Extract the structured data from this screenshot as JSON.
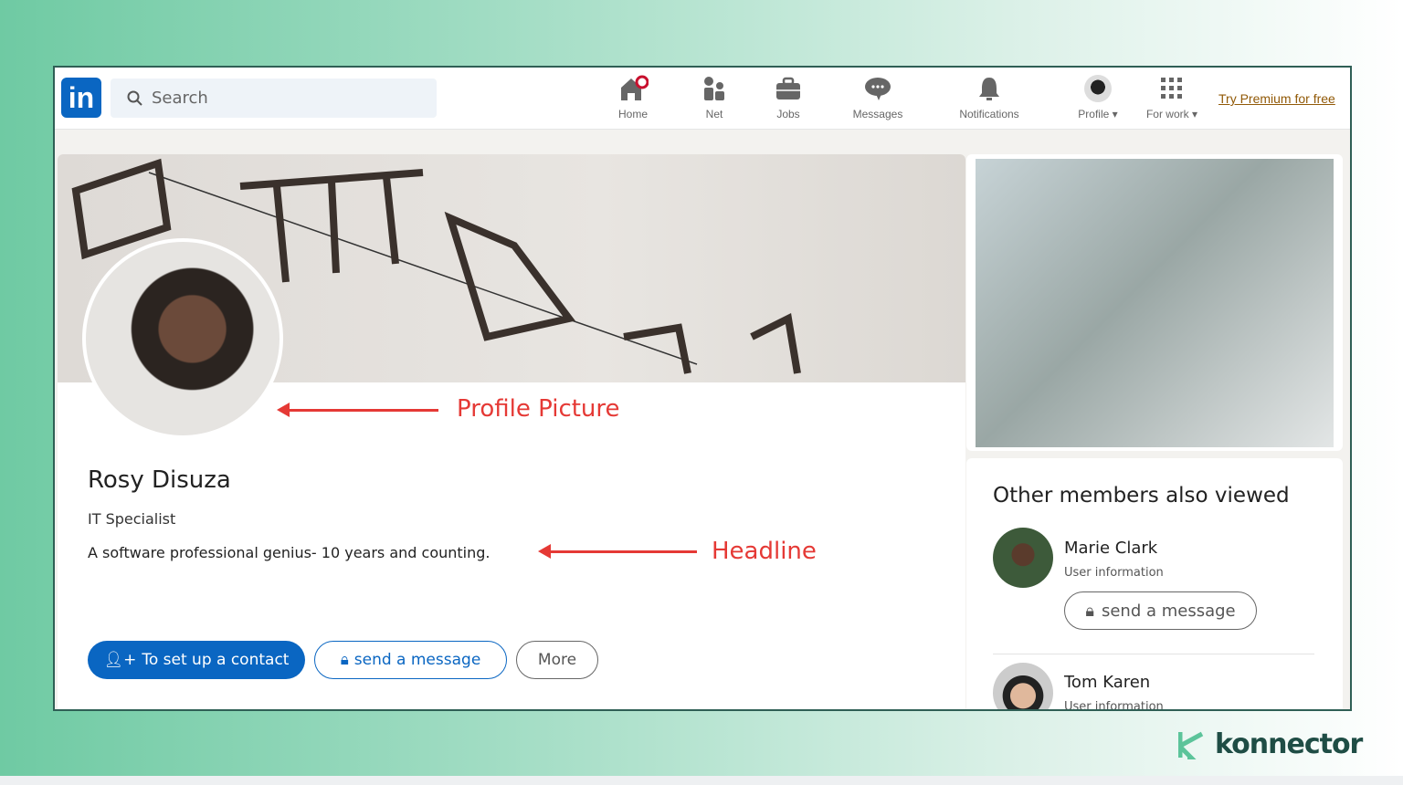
{
  "nav": {
    "logo": "in",
    "search_placeholder": "Search",
    "items": [
      {
        "label": "Home",
        "icon": "home-icon"
      },
      {
        "label": "Net",
        "icon": "network-icon"
      },
      {
        "label": "Jobs",
        "icon": "briefcase-icon"
      },
      {
        "label": "Messages",
        "icon": "chat-icon"
      },
      {
        "label": "Notifications",
        "icon": "bell-icon"
      },
      {
        "label": "Profile",
        "icon": "avatar"
      },
      {
        "label": "For work",
        "icon": "grid-icon"
      }
    ],
    "premium": "Try Premium for free"
  },
  "profile": {
    "name": "Rosy Disuza",
    "title": "IT Specialist",
    "headline": "A software professional genius- 10 years and counting.",
    "buttons": {
      "connect": "To set up a contact",
      "message": "send a message",
      "more": "More"
    }
  },
  "annotations": {
    "picture": "Profile Picture",
    "headline": "Headline",
    "color": "#e53935"
  },
  "sidebar": {
    "title": "Other members also viewed",
    "members": [
      {
        "name": "Marie Clark",
        "info": "User information",
        "button": "send a message"
      },
      {
        "name": "Tom Karen",
        "info": "User information"
      }
    ]
  },
  "brand": {
    "name": "konnector"
  },
  "colors": {
    "accent": "#0a66c2",
    "frame": "#2f5f55"
  }
}
